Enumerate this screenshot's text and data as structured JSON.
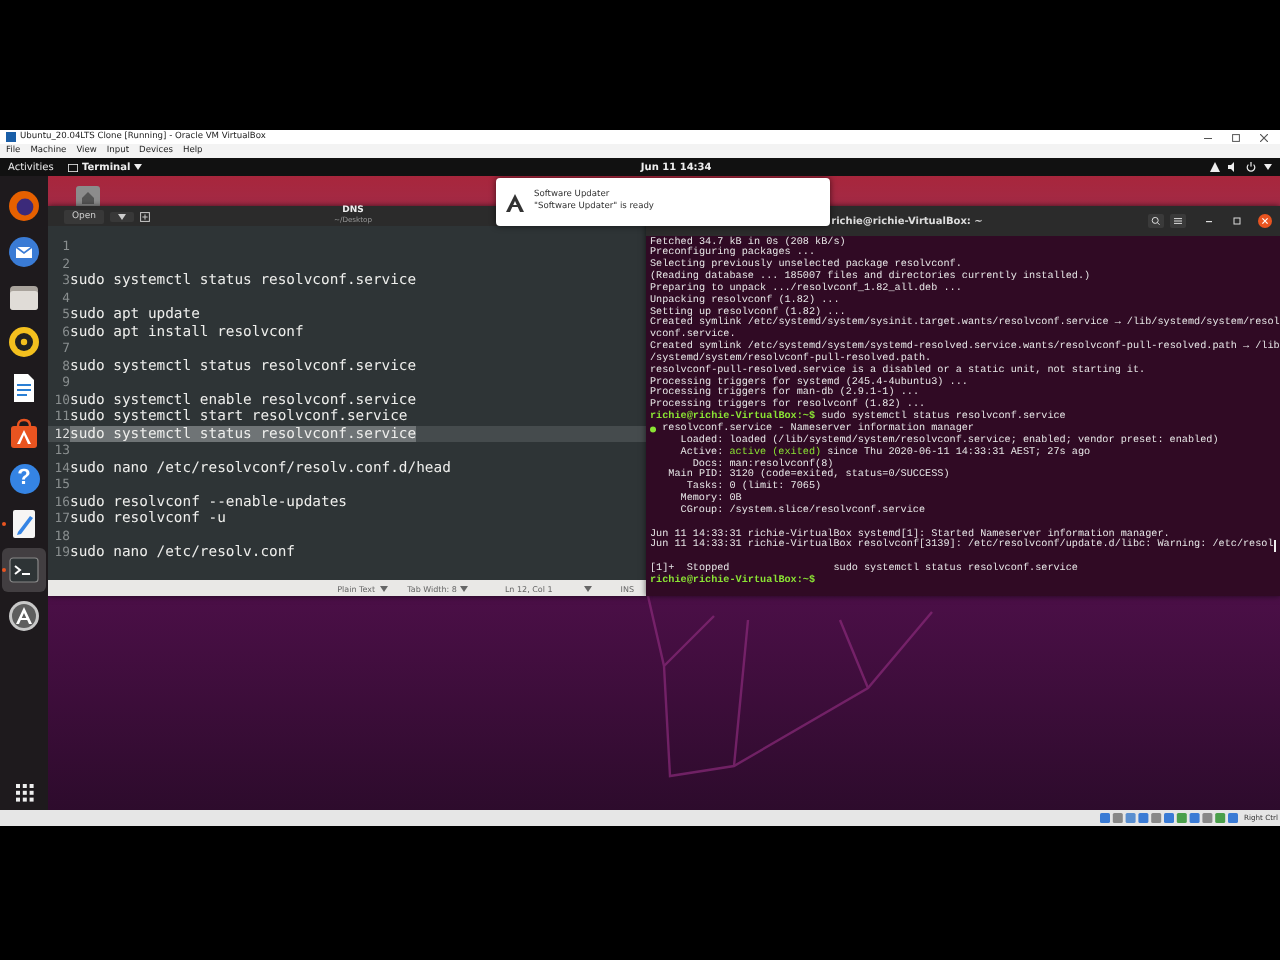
{
  "vbox": {
    "title": "Ubuntu_20.04LTS Clone [Running] - Oracle VM VirtualBox",
    "menu": [
      "File",
      "Machine",
      "View",
      "Input",
      "Devices",
      "Help"
    ],
    "status_text": "Right Ctrl"
  },
  "topbar": {
    "activities": "Activities",
    "app_menu": "Terminal",
    "clock": "Jun 11 14:34"
  },
  "dock": [
    {
      "kind": "browser",
      "running": false,
      "selected": false
    },
    {
      "kind": "mail",
      "running": false,
      "selected": false
    },
    {
      "kind": "files",
      "running": false,
      "selected": false
    },
    {
      "kind": "music",
      "running": false,
      "selected": false
    },
    {
      "kind": "writer",
      "running": false,
      "selected": false
    },
    {
      "kind": "software",
      "running": false,
      "selected": false
    },
    {
      "kind": "help",
      "glyph": "?",
      "running": false,
      "selected": false
    },
    {
      "kind": "editor",
      "running": true,
      "selected": false
    },
    {
      "kind": "terminal",
      "running": true,
      "selected": true
    },
    {
      "kind": "updater",
      "running": false,
      "selected": false
    }
  ],
  "editor": {
    "open": "Open",
    "title": "DNS",
    "subtitle": "~/Desktop",
    "lines": [
      {
        "number": "1",
        "selected": false
      },
      {
        "number": "2",
        "selected": false
      },
      {
        "number": "3",
        "text": "sudo systemctl status resolvconf.service",
        "selected": false
      },
      {
        "number": "4",
        "selected": false
      },
      {
        "number": "5",
        "text": "sudo apt update",
        "selected": false
      },
      {
        "number": "6",
        "text": "sudo apt install resolvconf",
        "selected": false
      },
      {
        "number": "7",
        "selected": false
      },
      {
        "number": "8",
        "text": "sudo systemctl status resolvconf.service",
        "selected": false
      },
      {
        "number": "9",
        "selected": false
      },
      {
        "number": "10",
        "text": "sudo systemctl enable resolvconf.service",
        "selected": false
      },
      {
        "number": "11",
        "text": "sudo systemctl start resolvconf.service",
        "selected": false
      },
      {
        "number": "12",
        "text": "sudo systemctl status resolvconf.service",
        "selected": true
      },
      {
        "number": "13",
        "selected": false
      },
      {
        "number": "14",
        "text": "sudo nano /etc/resolvconf/resolv.conf.d/head",
        "selected": false
      },
      {
        "number": "15",
        "selected": false
      },
      {
        "number": "16",
        "text": "sudo resolvconf --enable-updates",
        "selected": false
      },
      {
        "number": "17",
        "text": "sudo resolvconf -u",
        "selected": false
      },
      {
        "number": "18",
        "selected": false
      },
      {
        "number": "19",
        "text": "sudo nano /etc/resolv.conf",
        "selected": false
      }
    ],
    "status": {
      "language": "Plain Text",
      "tab_width": "Tab Width: 8",
      "position": "Ln 12, Col 1",
      "mode": "INS"
    }
  },
  "terminal": {
    "title": "richie@richie-VirtualBox: ~",
    "lines": [
      {
        "kind": "output",
        "text": "Fetched 34.7 kB in 0s (208 kB/s)"
      },
      {
        "kind": "output",
        "text": "Preconfiguring packages ..."
      },
      {
        "kind": "output",
        "text": "Selecting previously unselected package resolvconf."
      },
      {
        "kind": "output",
        "text": "(Reading database ... 185007 files and directories currently installed.)"
      },
      {
        "kind": "output",
        "text": "Preparing to unpack .../resolvconf_1.82_all.deb ..."
      },
      {
        "kind": "output",
        "text": "Unpacking resolvconf (1.82) ..."
      },
      {
        "kind": "output",
        "text": "Setting up resolvconf (1.82) ..."
      },
      {
        "kind": "output",
        "text": "Created symlink /etc/systemd/system/sysinit.target.wants/resolvconf.service → /lib/systemd/system/resol"
      },
      {
        "kind": "output",
        "text": "vconf.service."
      },
      {
        "kind": "output",
        "text": "Created symlink /etc/systemd/system/systemd-resolved.service.wants/resolvconf-pull-resolved.path → /lib"
      },
      {
        "kind": "output",
        "text": "/systemd/system/resolvconf-pull-resolved.path."
      },
      {
        "kind": "output",
        "text": "resolvconf-pull-resolved.service is a disabled or a static unit, not starting it."
      },
      {
        "kind": "output",
        "text": "Processing triggers for systemd (245.4-4ubuntu3) ..."
      },
      {
        "kind": "output",
        "text": "Processing triggers for man-db (2.9.1-1) ..."
      },
      {
        "kind": "output",
        "text": "Processing triggers for resolvconf (1.82) ..."
      },
      {
        "kind": "prompt",
        "prompt": "richie@richie-VirtualBox:~$",
        "command": "sudo systemctl status resolvconf.service"
      },
      {
        "kind": "unit",
        "text": "resolvconf.service - Nameserver information manager"
      },
      {
        "kind": "field",
        "label": "Loaded:",
        "value": "loaded (/lib/systemd/system/resolvconf.service; enabled; vendor preset: enabled)"
      },
      {
        "kind": "active",
        "label": "Active:",
        "state": "active (exited)",
        "value": "since Thu 2020-06-11 14:33:31 AEST; 27s ago"
      },
      {
        "kind": "field",
        "label": "Docs:",
        "value": "man:resolvconf(8)"
      },
      {
        "kind": "field",
        "label": "Main PID:",
        "value": "3120 (code=exited, status=0/SUCCESS)"
      },
      {
        "kind": "field",
        "label": "Tasks:",
        "value": "0 (limit: 7065)"
      },
      {
        "kind": "field",
        "label": "Memory:",
        "value": "0B"
      },
      {
        "kind": "field",
        "label": "CGroup:",
        "value": "/system.slice/resolvconf.service"
      },
      {
        "kind": "blank"
      },
      {
        "kind": "output",
        "text": "Jun 11 14:33:31 richie-VirtualBox systemd[1]: Started Nameserver information manager."
      },
      {
        "kind": "output",
        "text": "Jun 11 14:33:31 richie-VirtualBox resolvconf[3139]: /etc/resolvconf/update.d/libc: Warning: /etc/resol",
        "cursor": true
      },
      {
        "kind": "blank"
      },
      {
        "kind": "output",
        "text": "[1]+  Stopped                 sudo systemctl status resolvconf.service"
      },
      {
        "kind": "prompt",
        "prompt": "richie@richie-VirtualBox:~$"
      }
    ]
  },
  "notification": {
    "title": "Software Updater",
    "body": "\"Software Updater\" is ready"
  }
}
